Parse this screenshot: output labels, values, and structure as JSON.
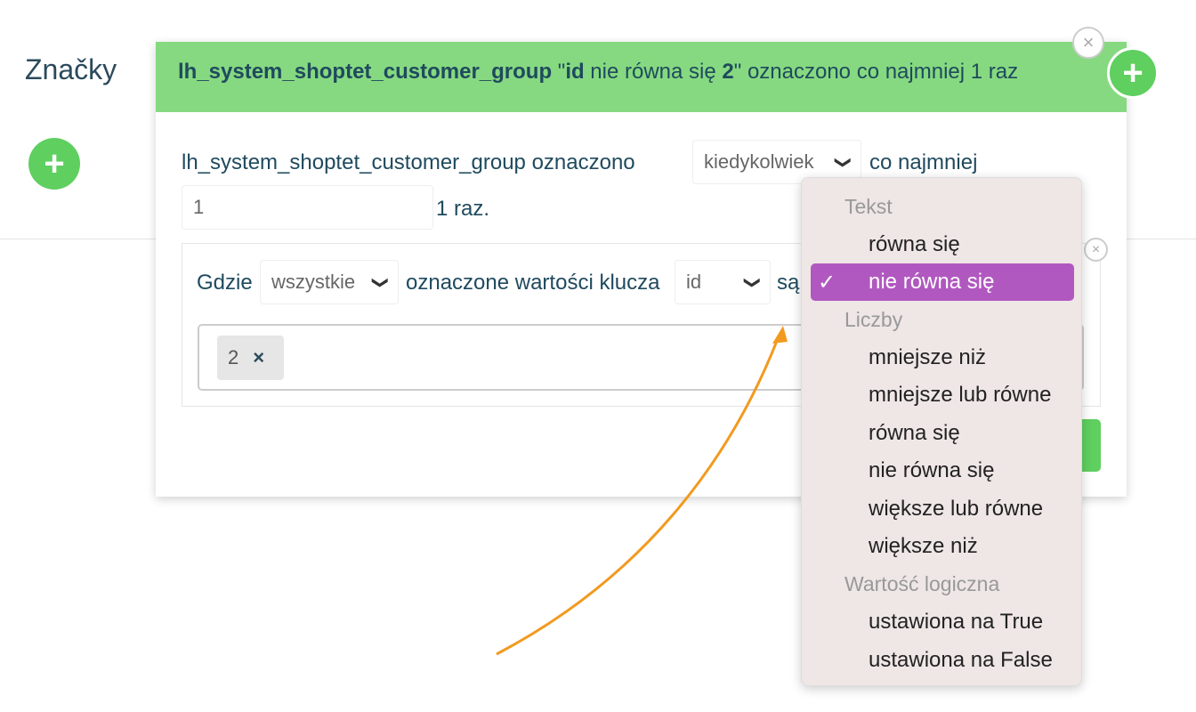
{
  "page_title": "Značky",
  "banner": {
    "tag": "lh_system_shoptet_customer_group",
    "q_open": " \"",
    "key": "id",
    "op": " nie równa się ",
    "value": "2",
    "rest": "\" oznaczono co najmniej 1 raz"
  },
  "form": {
    "tag_name": "lh_system_shoptet_customer_group",
    "tagged": "oznaczono",
    "when_select": "kiedykolwiek",
    "at_least": "co najmniej",
    "count_value": "1",
    "times": "1 raz.",
    "where": "Gdzie",
    "all_select": "wszystkie",
    "key_values": "oznaczone wartości klucza",
    "key_select": "id",
    "are": "są",
    "chip_value": "2",
    "chip_remove": "×"
  },
  "dropdown": {
    "groups": [
      {
        "label": "Tekst",
        "items": [
          "równa się",
          "nie równa się"
        ]
      },
      {
        "label": "Liczby",
        "items": [
          "mniejsze niż",
          "mniejsze lub równe",
          "równa się",
          "nie równa się",
          "większe lub równe",
          "większe niż"
        ]
      },
      {
        "label": "Wartość logiczna",
        "items": [
          "ustawiona na True",
          "ustawiona na False"
        ]
      }
    ],
    "selected": "nie równa się",
    "check": "✓"
  },
  "icons": {
    "plus": "+",
    "close": "×",
    "chevron": "⌄"
  },
  "colors": {
    "green": "#86d980",
    "accent": "#5fcf60",
    "selected": "#b158c0",
    "arrow": "#f29a1f"
  }
}
